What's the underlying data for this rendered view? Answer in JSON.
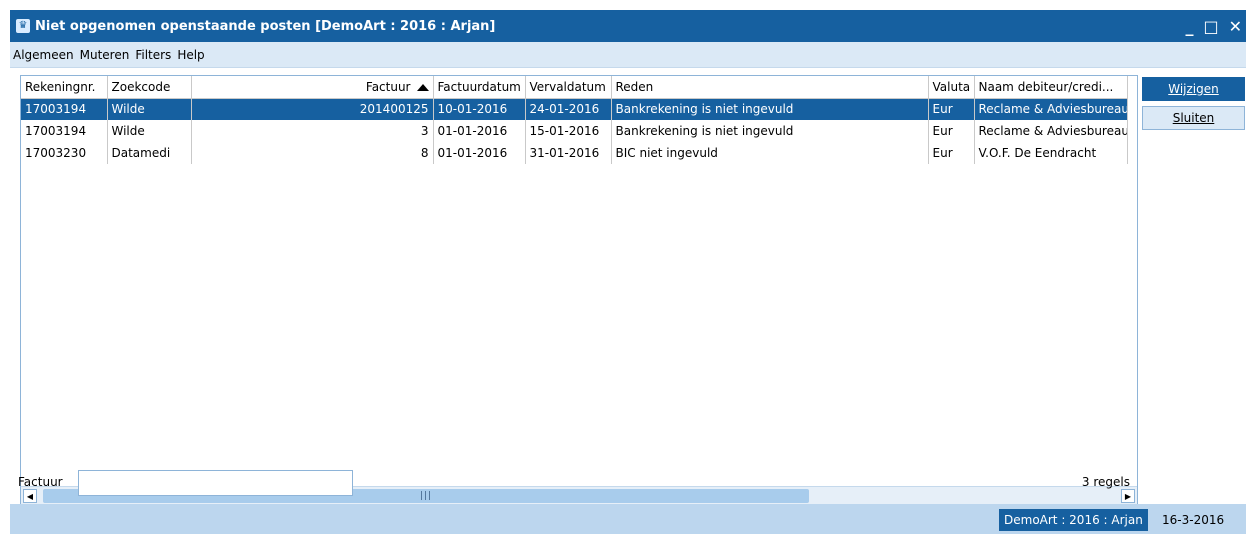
{
  "window": {
    "title": "Niet opgenomen openstaande posten [DemoArt : 2016 : Arjan]",
    "controls": {
      "minimize": "_",
      "maximize": "□",
      "close": "✕"
    }
  },
  "menu": [
    "Algemeen",
    "Muteren",
    "Filters",
    "Help"
  ],
  "table": {
    "columns": [
      "Rekeningnr.",
      "Zoekcode",
      "Factuur",
      "Factuurdatum",
      "Vervaldatum",
      "Reden",
      "Valuta",
      "Naam debiteur/credi..."
    ],
    "sorted_column": "Factuur",
    "sort_direction": "ascending",
    "rows": [
      [
        "17003194",
        "Wilde",
        "201400125",
        "10-01-2016",
        "24-01-2016",
        "Bankrekening is niet ingevuld",
        "Eur",
        "Reclame & Adviesbureau"
      ],
      [
        "17003194",
        "Wilde",
        "3",
        "01-01-2016",
        "15-01-2016",
        "Bankrekening is niet ingevuld",
        "Eur",
        "Reclame & Adviesbureau"
      ],
      [
        "17003230",
        "Datamedi",
        "8",
        "01-01-2016",
        "31-01-2016",
        "BIC niet ingevuld",
        "Eur",
        "V.O.F. De Eendracht"
      ]
    ],
    "selected_row": 0
  },
  "buttons": {
    "edit": "Wijzigen",
    "close": "Sluiten"
  },
  "filter": {
    "label": "Factuur",
    "value": ""
  },
  "row_count": "3 regels",
  "status": {
    "company": "DemoArt : 2016 : Arjan",
    "date": "16-3-2016"
  },
  "colors": {
    "accent": "#1660a0",
    "menu_bg": "#dbe9f6",
    "status_bg": "#bcd6ee"
  }
}
